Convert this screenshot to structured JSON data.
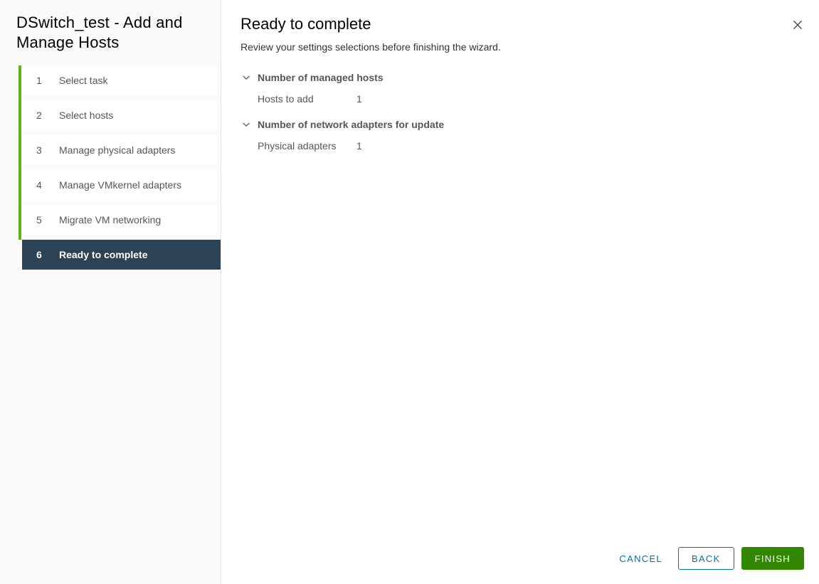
{
  "wizard": {
    "title": "DSwitch_test - Add and Manage Hosts",
    "close_icon": "close-icon",
    "accent_green": "#60b515",
    "active_step_bg": "#2c4356"
  },
  "sidebar": {
    "steps": [
      {
        "number": "1",
        "label": "Select task",
        "active": false
      },
      {
        "number": "2",
        "label": "Select hosts",
        "active": false
      },
      {
        "number": "3",
        "label": "Manage physical adapters",
        "active": false
      },
      {
        "number": "4",
        "label": "Manage VMkernel adapters",
        "active": false
      },
      {
        "number": "5",
        "label": "Migrate VM networking",
        "active": false
      },
      {
        "number": "6",
        "label": "Ready to complete",
        "active": true
      }
    ]
  },
  "main": {
    "title": "Ready to complete",
    "subtitle": "Review your settings selections before finishing the wizard.",
    "sections": [
      {
        "title": "Number of managed hosts",
        "expanded": true,
        "chevron_icon": "chevron-down-icon",
        "rows": [
          {
            "label": "Hosts to add",
            "value": "1"
          }
        ]
      },
      {
        "title": "Number of network adapters for update",
        "expanded": true,
        "chevron_icon": "chevron-down-icon",
        "rows": [
          {
            "label": "Physical adapters",
            "value": "1"
          }
        ]
      }
    ]
  },
  "footer": {
    "cancel_label": "CANCEL",
    "back_label": "BACK",
    "finish_label": "FINISH",
    "finish_color": "#318700",
    "link_color": "#0072a3"
  }
}
